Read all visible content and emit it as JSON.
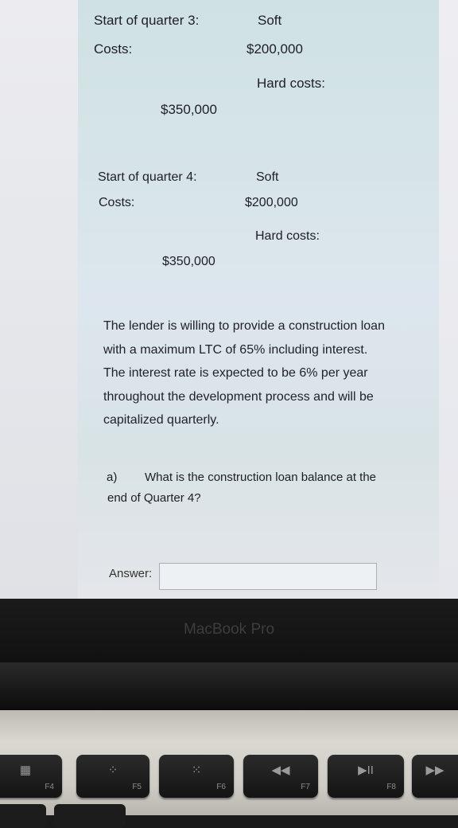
{
  "document": {
    "q3": {
      "heading_line1": "Start of quarter 3:",
      "heading_line2": "Costs:",
      "soft_label": "Soft",
      "soft_value": "$200,000",
      "hard_label": "Hard costs:",
      "hard_value": "$350,000"
    },
    "q4": {
      "heading_line1": "Start of quarter 4:",
      "heading_line2": "Costs:",
      "soft_label": "Soft",
      "soft_value": "$200,000",
      "hard_label": "Hard costs:",
      "hard_value": "$350,000"
    },
    "paragraph_lines": [
      "The lender is willing to provide a construction loan",
      "with a maximum LTC of 65% including interest.",
      "The interest rate is expected to be 6% per year",
      "throughout the development process and will be",
      "capitalized quarterly."
    ],
    "question": {
      "label": "a)",
      "line1": "What is the construction loan balance at the",
      "line2": "end of Quarter 4?"
    },
    "answer": {
      "label": "Answer:",
      "value": ""
    }
  },
  "device": {
    "bezel_label": "MacBook Pro",
    "keys": [
      {
        "icon": "launchpad-icon",
        "glyph": "▦",
        "fn": "F4"
      },
      {
        "icon": "keyboard-brightness-down-icon",
        "glyph": "⁘",
        "fn": "F5"
      },
      {
        "icon": "keyboard-brightness-up-icon",
        "glyph": "⁙",
        "fn": "F6"
      },
      {
        "icon": "rewind-icon",
        "glyph": "◀◀",
        "fn": "F7"
      },
      {
        "icon": "play-pause-icon",
        "glyph": "▶II",
        "fn": "F8"
      },
      {
        "icon": "fast-forward-icon",
        "glyph": "▶▶",
        "fn": ""
      }
    ]
  },
  "colors": {
    "text": "#1e1e24",
    "bezel": "#111111",
    "bezel_label": "#3d3d3f"
  }
}
